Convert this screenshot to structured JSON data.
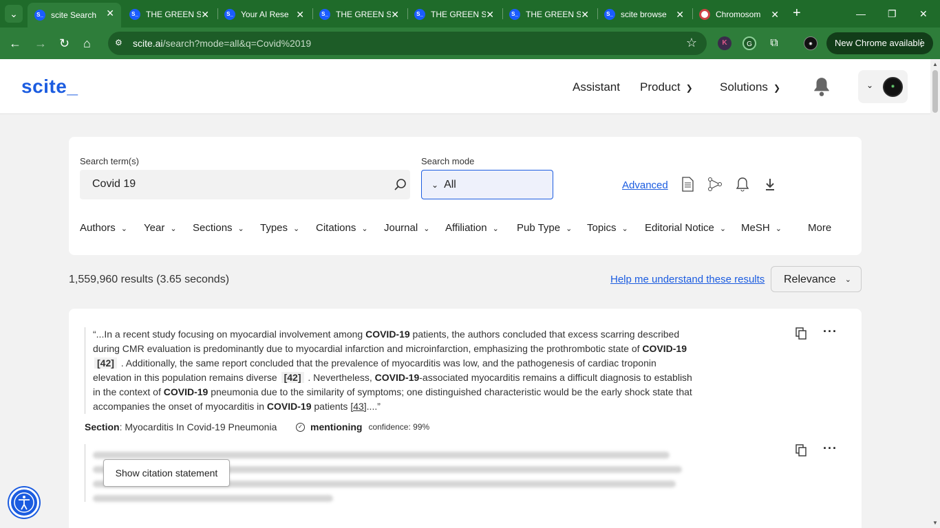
{
  "browser": {
    "tabs": [
      {
        "title": "scite Search",
        "favicon": "scite-icon",
        "active": true
      },
      {
        "title": "THE GREEN S",
        "favicon": "scite-icon",
        "active": false
      },
      {
        "title": "Your AI Rese",
        "favicon": "scite-icon",
        "active": false
      },
      {
        "title": "THE GREEN S",
        "favicon": "scite-icon",
        "active": false
      },
      {
        "title": "THE GREEN S",
        "favicon": "scite-icon",
        "active": false
      },
      {
        "title": "THE GREEN S",
        "favicon": "scite-icon",
        "active": false
      },
      {
        "title": "scite browse",
        "favicon": "scite-icon",
        "active": false
      },
      {
        "title": "Chromosom",
        "favicon": "chromosome-icon",
        "active": false
      }
    ],
    "url_host": "scite.ai",
    "url_path": "/search?mode=all&q=Covid%2019",
    "new_chrome_label": "New Chrome available",
    "accent_color": "#2e7d3a"
  },
  "site": {
    "logo": "scite_",
    "nav": {
      "assistant": "Assistant",
      "product": "Product",
      "solutions": "Solutions"
    },
    "brand_color": "#1b5ce0"
  },
  "search": {
    "term_label": "Search term(s)",
    "term_value": "Covid 19",
    "mode_label": "Search mode",
    "mode_value": "All",
    "advanced_label": "Advanced",
    "filters": [
      "Authors",
      "Year",
      "Sections",
      "Types",
      "Citations",
      "Journal",
      "Affiliation",
      "Pub Type",
      "Topics",
      "Editorial Notice",
      "MeSH",
      "More"
    ]
  },
  "results": {
    "count_text": "1,559,960 results (3.65 seconds)",
    "help_link": "Help me understand these results",
    "sort_value": "Relevance"
  },
  "result1": {
    "q1": "“...In a recent study focusing on myocardial involvement among ",
    "k1": "COVID-19",
    "q2": " patients, the authors concluded that excess scarring described during CMR evaluation is predominantly due to myocardial infarction and microinfarction, emphasizing the prothrombotic state of ",
    "k2": "COVID-19",
    "r1": "[42]",
    "q3": " . Additionally, the same report concluded that the prevalence of myocarditis was low, and the pathogenesis of cardiac troponin elevation in this population remains diverse ",
    "r2": "[42]",
    "q4": " . Nevertheless, ",
    "k3": "COVID-19",
    "q5": "-associated myocarditis remains a difficult diagnosis to establish in the context of ",
    "k4": "COVID-19",
    "q6": " pneumonia due to the similarity of symptoms; one distinguished characteristic would be the early shock state that accompanies the onset of myocarditis in ",
    "k5": "COVID-19",
    "q7": " patients ",
    "r3": "[43]",
    "q8": "....”",
    "section_label": "Section",
    "section_value": ": Myocarditis In Covid-19 Pneumonia",
    "type": "mentioning",
    "confidence": "confidence: 99%"
  },
  "result2": {
    "show_label": "Show citation statement"
  }
}
